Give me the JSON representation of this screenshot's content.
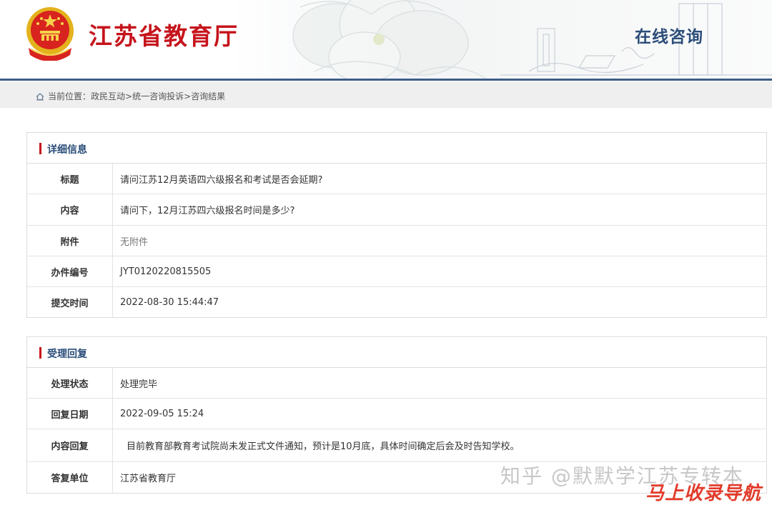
{
  "header": {
    "site_title": "江苏省教育厅",
    "section_tag": "在线咨询",
    "emblem_icon": "national-emblem-icon",
    "brand_color": "#c6141c",
    "accent_color": "#3d5d86"
  },
  "breadcrumb": {
    "icon": "home-icon",
    "prefix": "当前位置：",
    "item1": "政民互动",
    "sep1": "> ",
    "item2": "统一咨询投诉",
    "sep2": "> ",
    "item3": "咨询结果"
  },
  "detail": {
    "title": "详细信息",
    "rows": [
      {
        "label": "标题",
        "value": "请问江苏12月英语四六级报名和考试是否会延期?"
      },
      {
        "label": "内容",
        "value": "请问下，12月江苏四六级报名时间是多少?"
      },
      {
        "label": "附件",
        "value": "无附件"
      },
      {
        "label": "办件编号",
        "value": "JYT0120220815505"
      },
      {
        "label": "提交时间",
        "value": "2022-08-30 15:44:47"
      }
    ]
  },
  "reply": {
    "title": "受理回复",
    "rows": [
      {
        "label": "处理状态",
        "value": "处理完毕"
      },
      {
        "label": "回复日期",
        "value": "2022-09-05 15:24"
      },
      {
        "label": "内容回复",
        "value": "目前教育部教育考试院尚未发正式文件通知，预计是10月底，具体时间确定后会及时告知学校。"
      },
      {
        "label": "答复单位",
        "value": "江苏省教育厅"
      }
    ]
  },
  "watermark": {
    "line1": "知乎 @默默学江苏专转本",
    "line2": "马上收录导航"
  }
}
